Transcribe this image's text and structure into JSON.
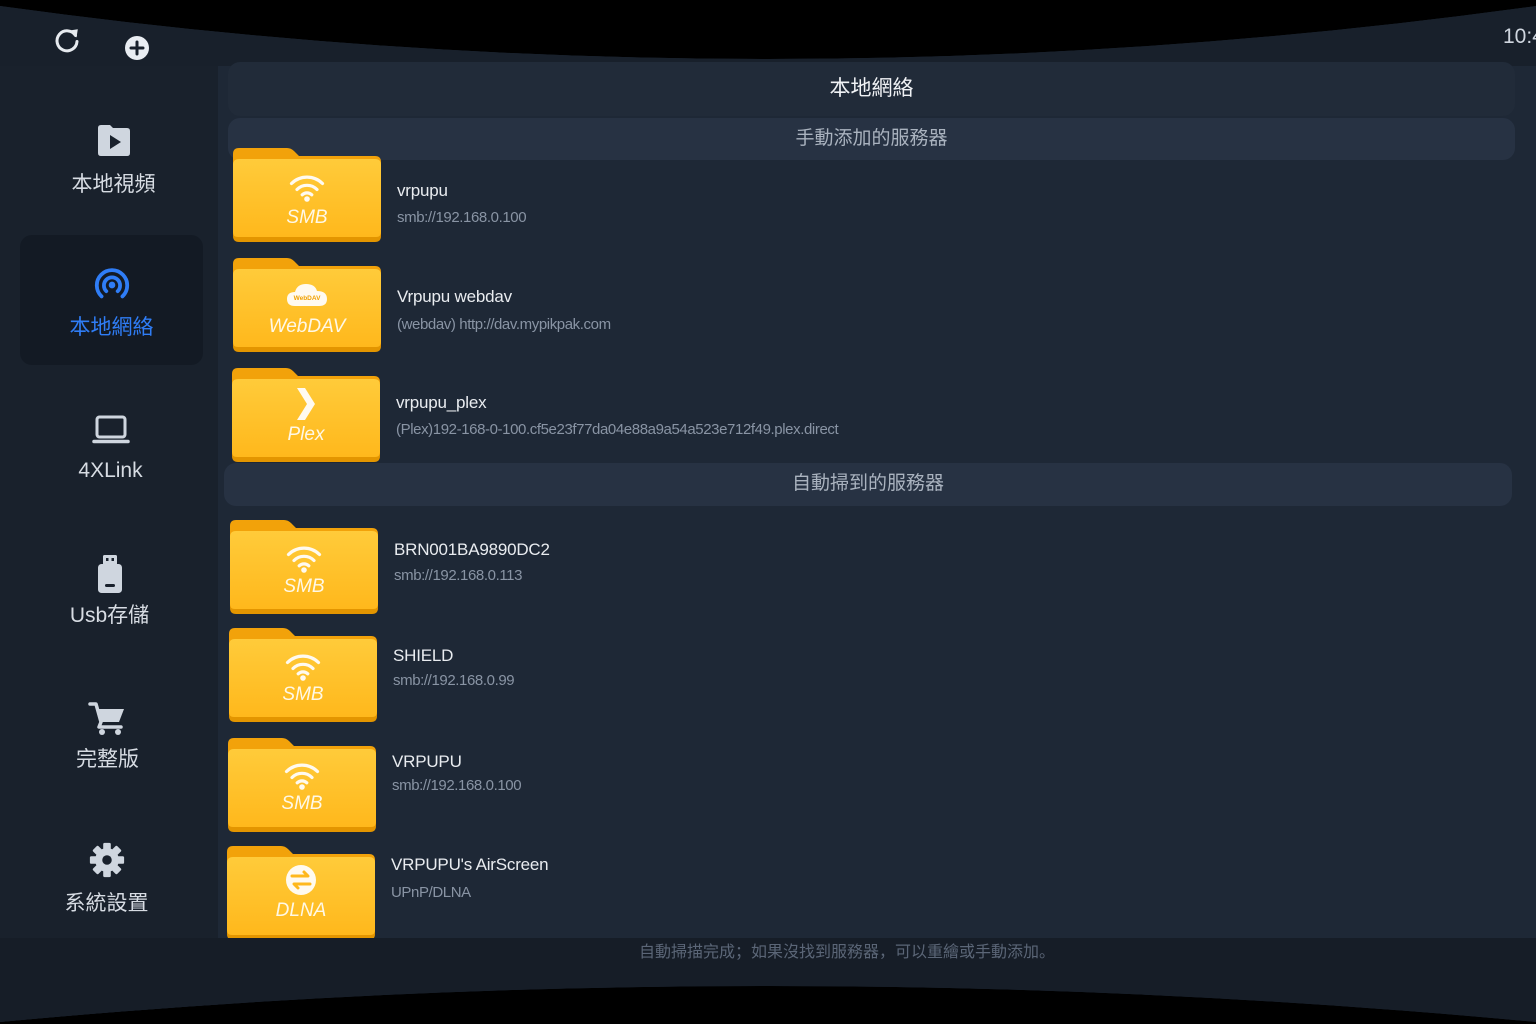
{
  "status_bar": {
    "clock": "10:4"
  },
  "toolbar": {
    "buttons": [
      {
        "icon": "refresh-icon"
      },
      {
        "icon": "add-circle-icon"
      }
    ]
  },
  "sidebar": {
    "items": [
      {
        "label": "本地視頻",
        "icon": "play-folder-icon",
        "selected": false
      },
      {
        "label": "本地網絡",
        "icon": "network-icon",
        "selected": true
      },
      {
        "label": "4XLink",
        "icon": "laptop-icon",
        "selected": false
      },
      {
        "label": "Usb存儲",
        "icon": "usb-drive-icon",
        "selected": false
      },
      {
        "label": "完整版",
        "icon": "cart-icon",
        "selected": false
      },
      {
        "label": "系統設置",
        "icon": "gear-icon",
        "selected": false
      }
    ]
  },
  "main": {
    "title": "本地網絡",
    "sections": [
      {
        "header": "手動添加的服務器",
        "servers": [
          {
            "name": "vrpupu",
            "address": "smb://192.168.0.100",
            "protocol": "SMB",
            "icon": "wifi-icon"
          },
          {
            "name": "Vrpupu webdav",
            "address": "(webdav) http://dav.mypikpak.com",
            "protocol": "WebDAV",
            "icon": "cloud-icon",
            "logo_text": "WebDAV"
          },
          {
            "name": "vrpupu_plex",
            "address": "(Plex)192-168-0-100.cf5e23f77da04e88a9a54a523e712f49.plex.direct",
            "protocol": "Plex",
            "icon": "plex-chevron-icon"
          }
        ]
      },
      {
        "header": "自動掃到的服務器",
        "servers": [
          {
            "name": "BRN001BA9890DC2",
            "address": "smb://192.168.0.113",
            "protocol": "SMB",
            "icon": "wifi-icon"
          },
          {
            "name": "SHIELD",
            "address": "smb://192.168.0.99",
            "protocol": "SMB",
            "icon": "wifi-icon"
          },
          {
            "name": "VRPUPU",
            "address": "smb://192.168.0.100",
            "protocol": "SMB",
            "icon": "wifi-icon"
          },
          {
            "name": "VRPUPU's AirScreen",
            "address": "UPnP/DLNA",
            "protocol": "DLNA",
            "icon": "dlna-icon"
          }
        ]
      }
    ],
    "footer_message": "自動掃描完成；如果沒找到服務器，可以重繪或手動添加。"
  },
  "colors": {
    "accent": "#2f7df6",
    "folder": "#ffc22d",
    "panel_background": "#1e2836"
  }
}
